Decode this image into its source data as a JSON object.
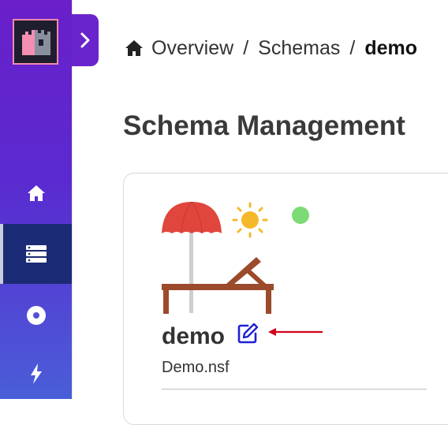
{
  "sidebar": {
    "items": [
      {
        "name": "home",
        "icon": "home-icon",
        "active": false
      },
      {
        "name": "schemas",
        "icon": "database-list-icon",
        "active": true
      },
      {
        "name": "disc",
        "icon": "disc-icon",
        "active": false
      },
      {
        "name": "lightning",
        "icon": "lightning-icon",
        "active": false
      }
    ],
    "colors": {
      "gradient_top": "#6a1fc9",
      "gradient_bottom": "#4a5ed8",
      "active_bg": "#1c2b75"
    }
  },
  "breadcrumb": {
    "items": [
      "Overview",
      "Schemas",
      "demo"
    ],
    "separator": "/"
  },
  "page": {
    "title": "Schema Management"
  },
  "card": {
    "name": "demo",
    "file": "Demo.nsf",
    "status_color": "#7cdb75",
    "edit_icon": "edit-icon",
    "edit_icon_color": "#1f1fd6",
    "annotation_arrow_color": "#d0021b"
  }
}
